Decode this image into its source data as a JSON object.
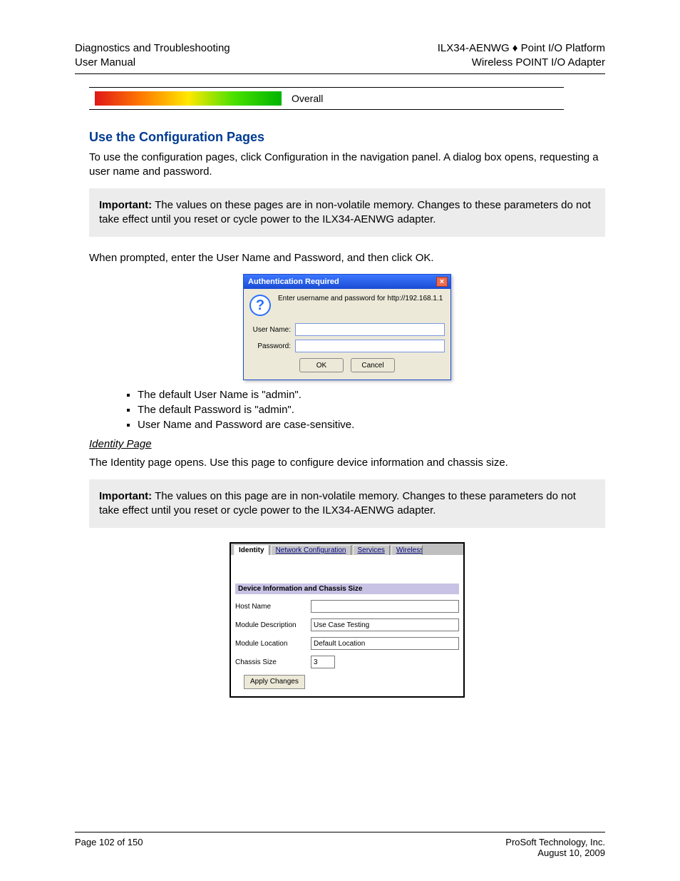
{
  "header": {
    "left_top": "Diagnostics and Troubleshooting",
    "left_bottom": "User Manual",
    "right_top_a": "ILX34-AENWG",
    "right_top_sep": " ♦ ",
    "right_top_b": "Point I/O Platform",
    "right_bottom": "Wireless POINT I/O Adapter"
  },
  "row_label": "Overall",
  "section1": {
    "heading": "Use the Configuration Pages",
    "p1": "To use the configuration pages, click Configuration in the navigation panel. A dialog box opens, requesting a user name and password.",
    "important_label": "Important:",
    "important_body": " The values on these pages are in non-volatile memory. Changes to these parameters do not take effect until you reset or cycle power to the ILX34-AENWG adapter.",
    "p2": "When prompted, enter the User Name and Password, and then click OK."
  },
  "dialog": {
    "title": "Authentication Required",
    "msg": "Enter username and password for http://192.168.1.1",
    "user_label": "User Name:",
    "pass_label": "Password:",
    "ok": "OK",
    "cancel": "Cancel",
    "close": "×"
  },
  "bullets": {
    "b1": "The default User Name is \"admin\".",
    "b2": "The default Password is \"admin\".",
    "b3": "User Name and Password are case-sensitive."
  },
  "identity": {
    "heading": "Identity Page",
    "p1": "The Identity page opens. Use this page to configure device information and chassis size.",
    "important_label": "Important:",
    "important_body": " The values on this page are in non-volatile memory. Changes to these parameters do not take effect until you reset or cycle power to the ILX34-AENWG adapter."
  },
  "panel": {
    "tabs": {
      "t1": "Identity",
      "t2": "Network Configuration",
      "t3": "Services",
      "t4": "Wireless S"
    },
    "group": "Device Information and Chassis Size",
    "host_label": "Host Name",
    "host_value": "",
    "desc_label": "Module Description",
    "desc_value": "Use Case Testing",
    "loc_label": "Module Location",
    "loc_value": "Default Location",
    "chassis_label": "Chassis Size",
    "chassis_value": "3",
    "apply": "Apply Changes"
  },
  "footer": {
    "left": "Page 102 of 150",
    "right_a": "ProSoft Technology, Inc.",
    "right_b": "August 10, 2009"
  }
}
